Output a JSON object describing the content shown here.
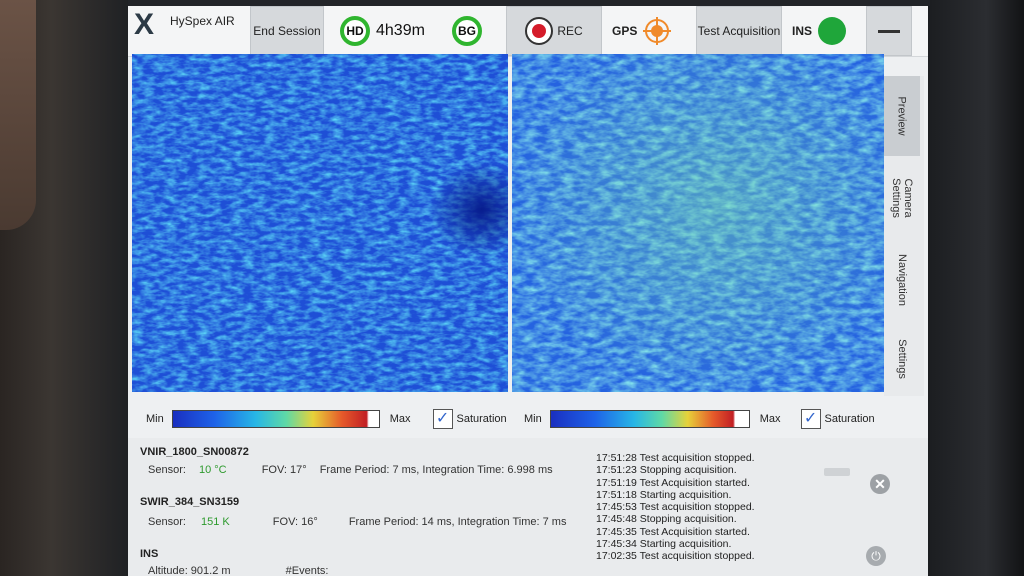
{
  "app": {
    "title": "HySpex AIR"
  },
  "toolbar": {
    "end_session": "End Session",
    "hd_label": "HD",
    "hd_time": "4h39m",
    "bg_label": "BG",
    "rec_label": "REC",
    "gps_label": "GPS",
    "test_acquisition": "Test Acquisition",
    "ins_label": "INS",
    "menu_icon": "minus-icon",
    "colors": {
      "status_ok": "#2fb52f",
      "rec": "#d51c2a",
      "gps": "#f08a2a"
    }
  },
  "side_tabs": [
    {
      "label": "Preview",
      "active": true
    },
    {
      "label": "Camera Settings",
      "active": false
    },
    {
      "label": "Navigation",
      "active": false
    },
    {
      "label": "Settings",
      "active": false
    }
  ],
  "colorbar_left": {
    "min": "Min",
    "max": "Max",
    "saturation": "Saturation",
    "saturation_checked": true
  },
  "colorbar_right": {
    "min": "Min",
    "max": "Max",
    "saturation": "Saturation",
    "saturation_checked": true
  },
  "sensors": {
    "vnir": {
      "name": "VNIR_1800_SN00872",
      "sensor_label": "Sensor:",
      "sensor_value": "10 °C",
      "fov": "FOV: 17°",
      "timing": "Frame Period: 7 ms, Integration Time: 6.998 ms"
    },
    "swir": {
      "name": "SWIR_384_SN3159",
      "sensor_label": "Sensor:",
      "sensor_value": "151 K",
      "fov": "FOV: 16°",
      "timing": "Frame Period: 14 ms, Integration Time: 7 ms"
    },
    "ins": {
      "name": "INS",
      "altitude": "Altitude: 901.2 m",
      "events": "#Events:"
    }
  },
  "log": [
    "17:51:28 Test acquisition stopped.",
    "17:51:23 Stopping acquisition.",
    "17:51:19 Test Acquisition started.",
    "17:51:18 Starting acquisition.",
    "17:45:53 Test acquisition stopped.",
    "17:45:48 Stopping acquisition.",
    "17:45:35 Test Acquisition started.",
    "17:45:34 Starting acquisition.",
    "17:02:35 Test acquisition stopped."
  ]
}
